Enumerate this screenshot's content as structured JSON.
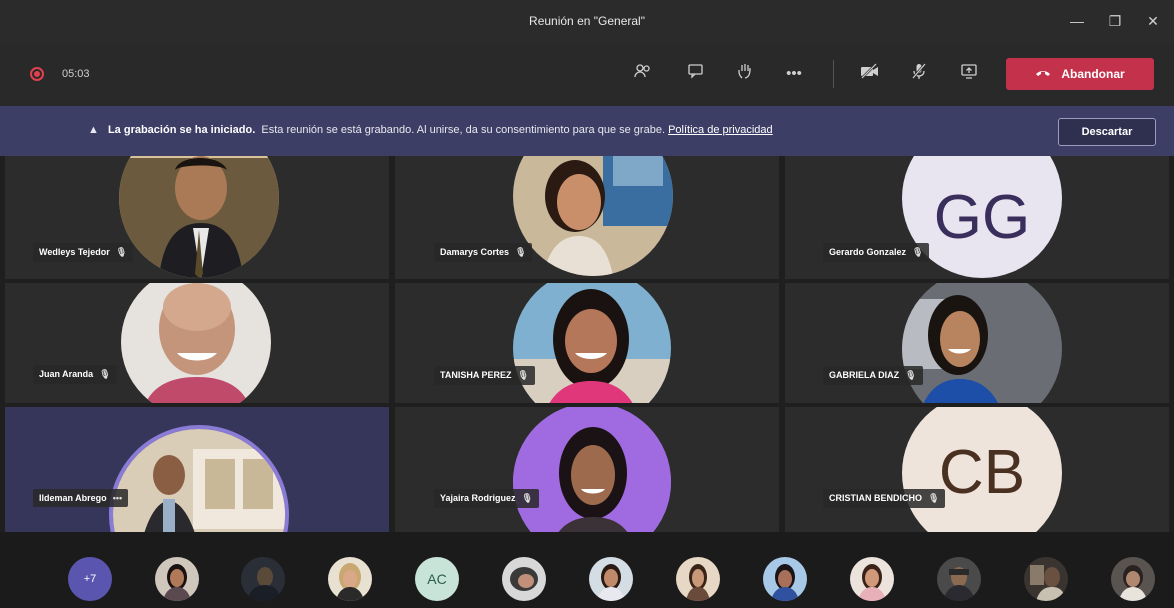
{
  "window": {
    "title": "Reunión en \"General\""
  },
  "toolbar": {
    "timer": "05:03",
    "leave_label": "Abandonar"
  },
  "banner": {
    "title": "La grabación se ha iniciado.",
    "message": "Esta reunión se está grabando. Al unirse, da su consentimiento para que se grabe.",
    "link": "Política de privacidad",
    "dismiss_label": "Descartar"
  },
  "participants": [
    {
      "name": "Wedleys Tejedor"
    },
    {
      "name": "Damarys Cortes"
    },
    {
      "name": "Gerardo Gonzalez",
      "initials": "GG"
    },
    {
      "name": "Juan Aranda"
    },
    {
      "name": "TANISHA PEREZ"
    },
    {
      "name": "GABRIELA DIAZ"
    },
    {
      "name": "Ildeman Abrego"
    },
    {
      "name": "Yajaira Rodriguez"
    },
    {
      "name": "CRISTIAN BENDICHO",
      "initials": "CB"
    }
  ],
  "bottom_bar": {
    "overflow_count": "+7",
    "initials_avatar": "AC"
  },
  "colors": {
    "leave": "#c4314b",
    "banner": "#3d3e66",
    "record": "#e0414f"
  }
}
